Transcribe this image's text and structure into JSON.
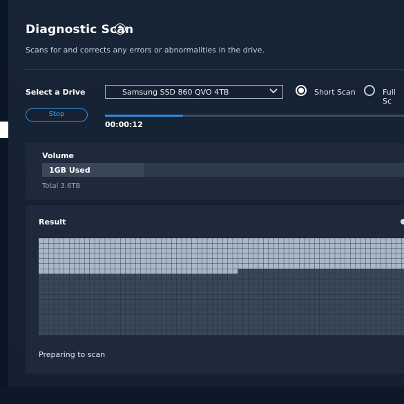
{
  "header": {
    "title": "Diagnostic Scan",
    "help_icon": "?",
    "subtitle": "Scans for and corrects any errors or abnormalities in the drive."
  },
  "drive": {
    "label": "Select a Drive",
    "selected": "Samsung SSD 860 QVO 4TB",
    "dropdown_icon": "chevron-down-icon"
  },
  "scan_type": {
    "short_label": "Short Scan",
    "full_label": "Full Sc",
    "selected": "short"
  },
  "controls": {
    "stop_label": "Stop"
  },
  "progress": {
    "fraction": 0.25,
    "elapsed": "00:00:12"
  },
  "volume": {
    "label": "Volume",
    "used": "1GB Used",
    "total": "Total 3.6TB",
    "used_fraction": 0.27
  },
  "result": {
    "label": "Result",
    "status": "Preparing to scan",
    "grid": {
      "columns": 75,
      "rows": 19,
      "bright_full_rows": 6,
      "bright_partial_columns": 39,
      "colors": {
        "bright": "#a9b7c8",
        "dim": "#3a4759"
      }
    }
  },
  "colors": {
    "accent": "#2f8de0",
    "background": "#162233",
    "card": "#1e2a3b"
  }
}
